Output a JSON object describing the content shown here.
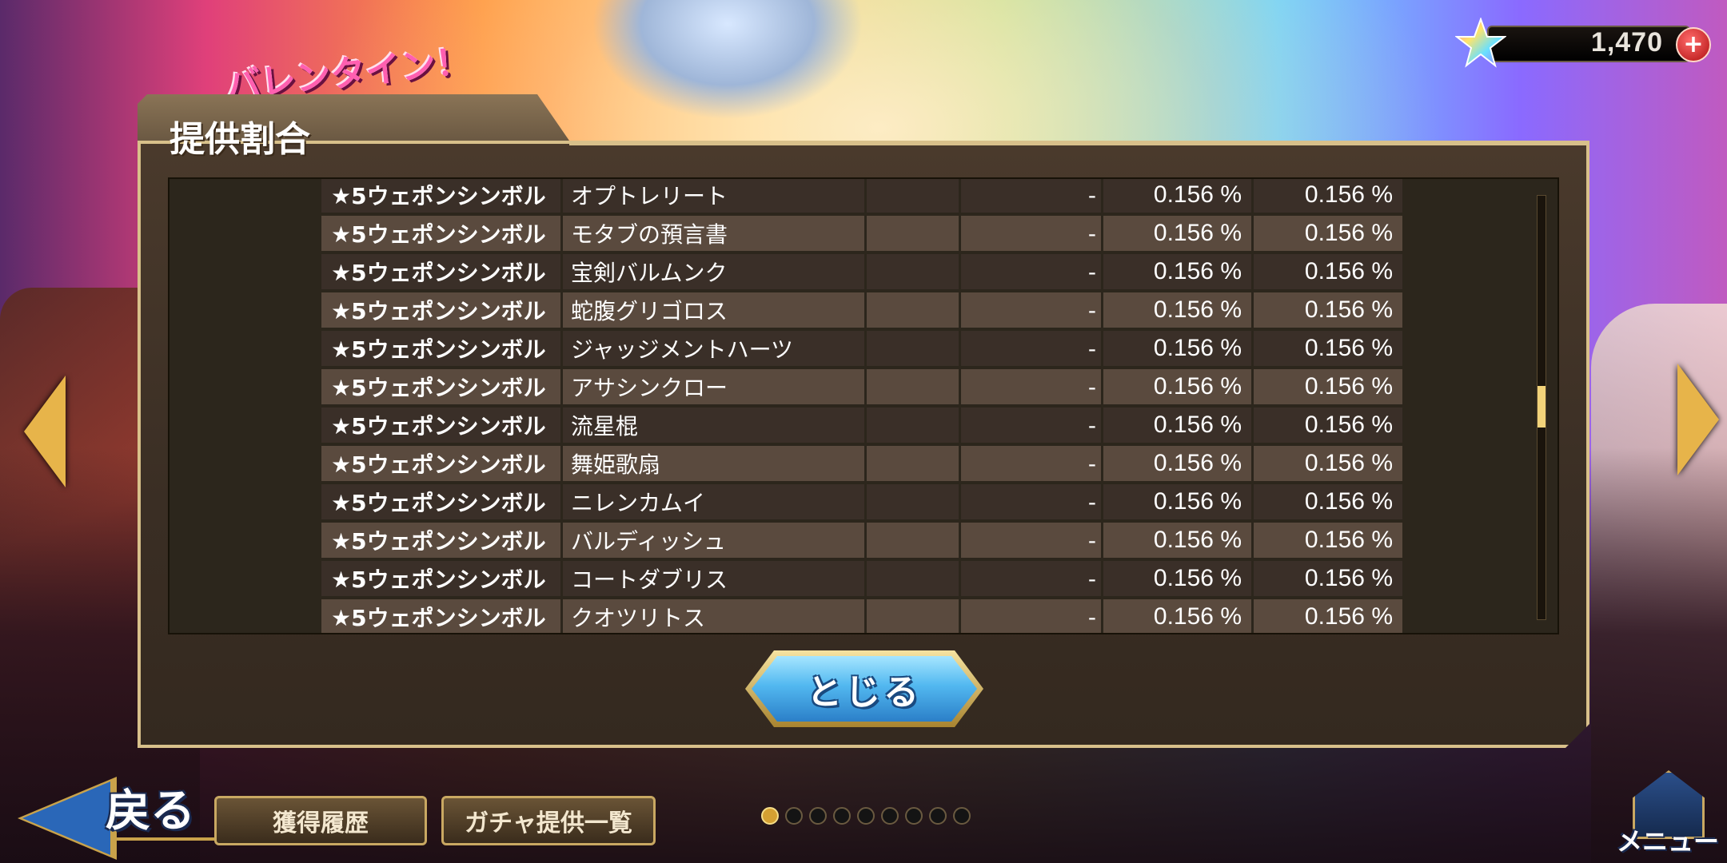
{
  "event_logo": "バレンタイン！",
  "currency": {
    "value": "1,470",
    "icon": "rainbow-star-gem-icon",
    "plus_icon": "plus-icon"
  },
  "dialog": {
    "title": "提供割合",
    "rows": [
      {
        "type": "★5ウェポンシンボル",
        "name": "オプトレリート",
        "col3": "",
        "col4": "-",
        "rate1": "0.156 %",
        "rate2": "0.156 %"
      },
      {
        "type": "★5ウェポンシンボル",
        "name": "モタブの預言書",
        "col3": "",
        "col4": "-",
        "rate1": "0.156 %",
        "rate2": "0.156 %"
      },
      {
        "type": "★5ウェポンシンボル",
        "name": "宝剣バルムンク",
        "col3": "",
        "col4": "-",
        "rate1": "0.156 %",
        "rate2": "0.156 %"
      },
      {
        "type": "★5ウェポンシンボル",
        "name": "蛇腹グリゴロス",
        "col3": "",
        "col4": "-",
        "rate1": "0.156 %",
        "rate2": "0.156 %"
      },
      {
        "type": "★5ウェポンシンボル",
        "name": "ジャッジメントハーツ",
        "col3": "",
        "col4": "-",
        "rate1": "0.156 %",
        "rate2": "0.156 %"
      },
      {
        "type": "★5ウェポンシンボル",
        "name": "アサシンクロー",
        "col3": "",
        "col4": "-",
        "rate1": "0.156 %",
        "rate2": "0.156 %"
      },
      {
        "type": "★5ウェポンシンボル",
        "name": "流星棍",
        "col3": "",
        "col4": "-",
        "rate1": "0.156 %",
        "rate2": "0.156 %"
      },
      {
        "type": "★5ウェポンシンボル",
        "name": "舞姫歌扇",
        "col3": "",
        "col4": "-",
        "rate1": "0.156 %",
        "rate2": "0.156 %"
      },
      {
        "type": "★5ウェポンシンボル",
        "name": "ニレンカムイ",
        "col3": "",
        "col4": "-",
        "rate1": "0.156 %",
        "rate2": "0.156 %"
      },
      {
        "type": "★5ウェポンシンボル",
        "name": "バルディッシュ",
        "col3": "",
        "col4": "-",
        "rate1": "0.156 %",
        "rate2": "0.156 %"
      },
      {
        "type": "★5ウェポンシンボル",
        "name": "コートダブリス",
        "col3": "",
        "col4": "-",
        "rate1": "0.156 %",
        "rate2": "0.156 %"
      },
      {
        "type": "★5ウェポンシンボル",
        "name": "クオツリトス",
        "col3": "",
        "col4": "-",
        "rate1": "0.156 %",
        "rate2": "0.156 %"
      }
    ],
    "close_label": "とじる"
  },
  "nav": {
    "back_label": "戻る",
    "history_label": "獲得履歴",
    "gacha_list_label": "ガチャ提供一覧",
    "menu_label": "メニュー",
    "page_count": 9,
    "active_page": 1
  },
  "colors": {
    "accent_gold": "#d8c08a",
    "button_blue": "#52b8f0",
    "row_dark": "#3a2f28",
    "row_light": "#5a4a3e"
  }
}
